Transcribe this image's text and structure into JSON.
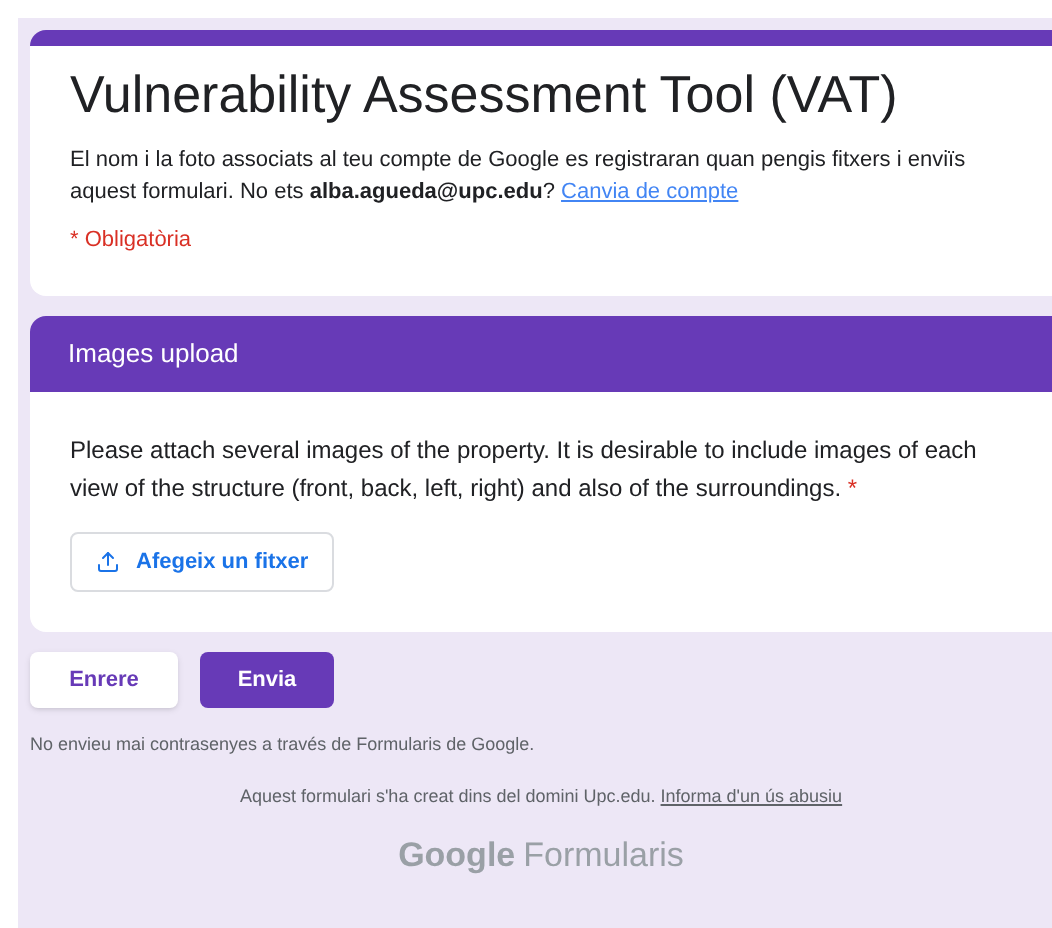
{
  "form": {
    "title": "Vulnerability Assessment Tool (VAT)",
    "notice": "El nom i la foto associats al teu compte de Google es registraran quan pengis fitxers i enviïs aquest formulari. No ets **alba.agueda@upc.edu**?",
    "switch_link": "Canvia de compte",
    "required_note": "* Obligatòria"
  },
  "section": {
    "title": "Images upload",
    "question": "Please attach several images of the property. It is desirable to include images of each view of the structure (front, back, left, right) and also of the surroundings.",
    "required_mark": "*",
    "upload_button": "Afegeix un fitxer"
  },
  "buttons": [
    {
      "label": "Enrere",
      "kind": "secondary"
    },
    {
      "label": "Envia",
      "kind": "primary"
    }
  ],
  "footer": {
    "password_warning": "No envieu mai contrasenyes a través de Formularis de Google.",
    "domain_note": "Aquest formulari s'ha creat dins del domini Upc.edu.",
    "abuse_link": "Informa d'un ús abusiu",
    "logo_brand": "Google",
    "logo_product": "Formularis"
  }
}
